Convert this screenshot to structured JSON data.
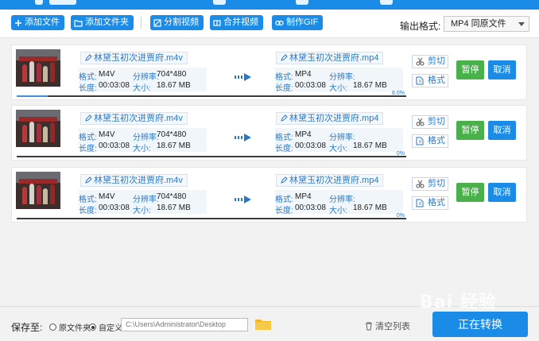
{
  "toolbar": {
    "add_file": "添加文件",
    "add_folder": "添加文件夹",
    "split_video": "分割视频",
    "merge_video": "合并视频",
    "make_gif": "制作GIF",
    "output_format_label": "输出格式:",
    "output_format_value": "MP4  同原文件"
  },
  "labels": {
    "format": "格式:",
    "resolution": "分辨率:",
    "duration": "长度:",
    "size": "大小:",
    "cut": "剪切",
    "format_btn": "格式",
    "pause": "暂停",
    "cancel": "取消"
  },
  "files": [
    {
      "source_name": "林黛玉初次进贾府.m4v",
      "source_format": "M4V",
      "source_resolution": "704*480",
      "source_duration": "00:03:08",
      "source_size": "18.67 MB",
      "target_name": "林黛玉初次进贾府.mp4",
      "target_format": "MP4",
      "target_resolution": "",
      "target_duration": "00:03:08",
      "target_size": "18.67 MB",
      "progress": 0.08,
      "progress_text": "8.0%"
    },
    {
      "source_name": "林黛玉初次进贾府.m4v",
      "source_format": "M4V",
      "source_resolution": "704*480",
      "source_duration": "00:03:08",
      "source_size": "18.67 MB",
      "target_name": "林黛玉初次进贾府.mp4",
      "target_format": "MP4",
      "target_resolution": "",
      "target_duration": "00:03:08",
      "target_size": "18.67 MB",
      "progress": 0,
      "progress_text": "0%"
    },
    {
      "source_name": "林黛玉初次进贾府.m4v",
      "source_format": "M4V",
      "source_resolution": "704*480",
      "source_duration": "00:03:08",
      "source_size": "18.67 MB",
      "target_name": "林黛玉初次进贾府.mp4",
      "target_format": "MP4",
      "target_resolution": "",
      "target_duration": "00:03:08",
      "target_size": "18.67 MB",
      "progress": 0,
      "progress_text": "0%"
    }
  ],
  "footer": {
    "save_to": "保存至:",
    "original_folder": "原文件夹",
    "custom": "自定义",
    "path": "C:\\Users\\Administrator\\Desktop",
    "clear_list": "清空列表",
    "start_convert": "正在转换"
  },
  "watermark": "Bai 经验",
  "colors": {
    "accent": "#1a8ce8",
    "pause": "#48b14a",
    "info_bg": "#f1f6fb"
  }
}
